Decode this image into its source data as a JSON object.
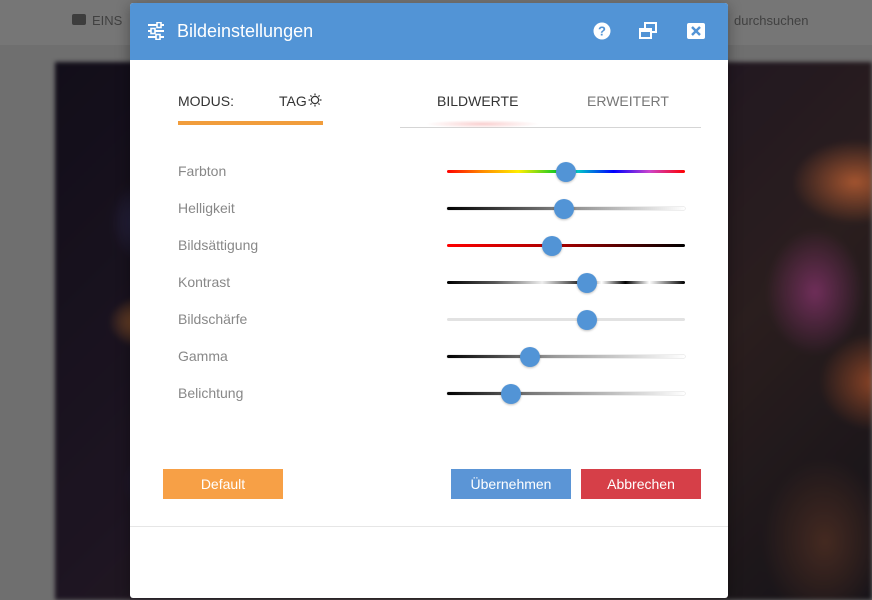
{
  "background": {
    "topbar_left": "EINS",
    "topbar_right": "durchsuchen"
  },
  "dialog": {
    "title": "Bildeinstellungen",
    "header_color": "#5294d6",
    "icons": [
      "sliders-icon",
      "help-icon",
      "restore-window-icon",
      "close-icon"
    ]
  },
  "mode": {
    "label": "MODUS:",
    "value": "TAG",
    "accent": "#f19d3c"
  },
  "tabs": [
    {
      "label": "BILDWERTE",
      "active": true
    },
    {
      "label": "ERWEITERT",
      "active": false
    }
  ],
  "sliders": [
    {
      "label": "Farbton",
      "value_fraction": 0.5
    },
    {
      "label": "Helligkeit",
      "value_fraction": 0.49
    },
    {
      "label": "Bildsättigung",
      "value_fraction": 0.44
    },
    {
      "label": "Kontrast",
      "value_fraction": 0.59
    },
    {
      "label": "Bildschärfe",
      "value_fraction": 0.59
    },
    {
      "label": "Gamma",
      "value_fraction": 0.35
    },
    {
      "label": "Belichtung",
      "value_fraction": 0.27
    }
  ],
  "buttons": {
    "default": "Default",
    "apply": "Übernehmen",
    "cancel": "Abbrechen"
  },
  "colors": {
    "default_button": "#f7a046",
    "apply_button": "#5b95d6",
    "cancel_button": "#d63f48",
    "slider_thumb": "#5294d6"
  }
}
